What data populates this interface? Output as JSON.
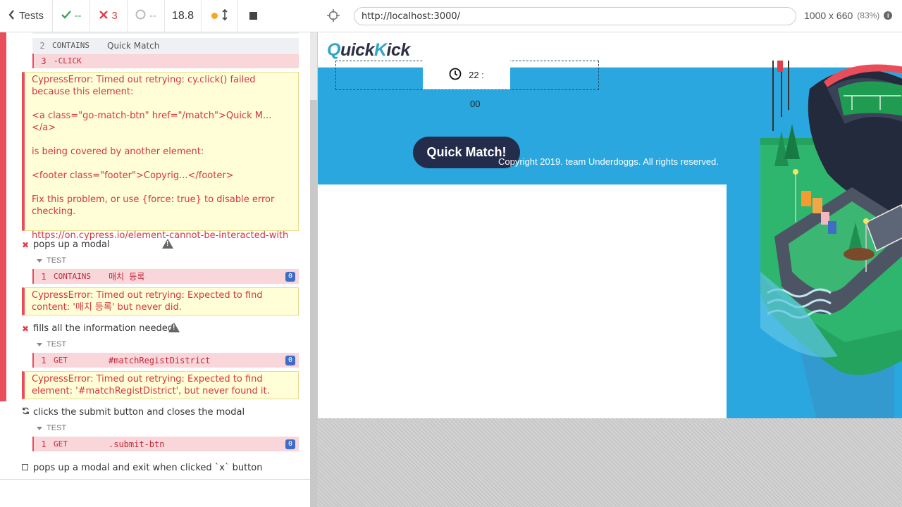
{
  "reporter": {
    "header": {
      "tests_label": "Tests",
      "passed": "--",
      "failed": "3",
      "pending": "--",
      "duration": "18.8"
    },
    "commands_top": [
      {
        "num": "2",
        "name": "CONTAINS",
        "msg": "Quick Match"
      },
      {
        "num": "3",
        "name": "-CLICK",
        "msg": ""
      }
    ],
    "error_click": [
      "CypressError: Timed out retrying: cy.click() failed because this element:",
      "<a class=\"go-match-btn\" href=\"/match\">Quick M...</a>",
      "is being covered by another element:",
      "<footer class=\"footer\">Copyrig...</footer>",
      "Fix this problem, or use {force: true} to disable error checking.",
      "https://on.cypress.io/element-cannot-be-interacted-with"
    ],
    "tests": [
      {
        "title": "pops up a modal",
        "label": "TEST",
        "cmd": {
          "num": "1",
          "name": "CONTAINS",
          "msg": "매치 등록",
          "badge": "0"
        },
        "error": "CypressError: Timed out retrying: Expected to find content: '매치 등록' but never did."
      },
      {
        "title": "fills all the information needed",
        "label": "TEST",
        "cmd": {
          "num": "1",
          "name": "GET",
          "msg": "#matchRegistDistrict",
          "badge": "0"
        },
        "error": "CypressError: Timed out retrying: Expected to find element: '#matchRegistDistrict', but never found it."
      },
      {
        "title": "clicks the submit button and closes the modal",
        "label": "TEST",
        "cmd": {
          "num": "1",
          "name": "GET",
          "msg": ".submit-btn",
          "badge": "0"
        }
      },
      {
        "title": "pops up a modal and exit when clicked `x` button"
      }
    ]
  },
  "browser": {
    "url": "http://localhost:3000/",
    "viewport": "1000 x 660",
    "zoom": "(83%)"
  },
  "app": {
    "logo_prefix": "Q",
    "logo_mid": "uick",
    "logo_k": "K",
    "logo_suffix": "ick",
    "timer": "22 :",
    "timer_secs": "00",
    "quick_match": "Quick Match!",
    "copyright": "Copyright 2019. team Underdoggs. All rights reserved."
  },
  "colors": {
    "fail": "#e94d5a",
    "pass": "#3ea35b",
    "app_blue": "#2aa7de",
    "button_navy": "#232c4a"
  }
}
